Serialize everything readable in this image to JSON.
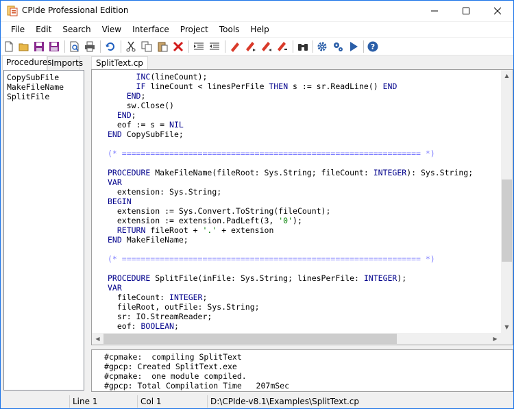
{
  "window": {
    "title": "CPIde Professional Edition"
  },
  "menu": [
    "File",
    "Edit",
    "Search",
    "View",
    "Interface",
    "Project",
    "Tools",
    "Help"
  ],
  "toolbar_icons": [
    "new-file-icon",
    "open-folder-icon",
    "save-icon",
    "save-all-icon",
    "print-preview-icon",
    "print-icon",
    "undo-icon",
    "cut-icon",
    "copy-icon",
    "paste-icon",
    "delete-icon",
    "indent-icon",
    "outdent-icon",
    "bookmark-icon",
    "bookmark-next-icon",
    "bookmark-prev-icon",
    "bookmark-clear-icon",
    "find-icon",
    "settings-icon",
    "build-icon",
    "run-icon",
    "help-icon"
  ],
  "left_panel": {
    "tabs": [
      "Procedures",
      "Imports"
    ],
    "items": [
      "CopySubFile",
      "MakeFileName",
      "SplitFile"
    ]
  },
  "editor": {
    "tab": "SplitText.cp",
    "lines": [
      "      INC(lineCount);",
      "      IF lineCount < linesPerFile THEN s := sr.ReadLine() END",
      "    END;",
      "    sw.Close()",
      "  END;",
      "  eof := s = NIL",
      "END CopySubFile;",
      "",
      "(* =============================================================== *)",
      "",
      "PROCEDURE MakeFileName(fileRoot: Sys.String; fileCount: INTEGER): Sys.String;",
      "VAR",
      "  extension: Sys.String;",
      "BEGIN",
      "  extension := Sys.Convert.ToString(fileCount);",
      "  extension := extension.PadLeft(3, '0');",
      "  RETURN fileRoot + '.' + extension",
      "END MakeFileName;",
      "",
      "(* =============================================================== *)",
      "",
      "PROCEDURE SplitFile(inFile: Sys.String; linesPerFile: INTEGER);",
      "VAR",
      "  fileCount: INTEGER;",
      "  fileRoot, outFile: Sys.String;",
      "  sr: IO.StreamReader;",
      "  eof: BOOLEAN;"
    ]
  },
  "output": {
    "lines": [
      "#cpmake:  compiling SplitText",
      "#gpcp: Created SplitText.exe",
      "#cpmake:  one module compiled.",
      "#gpcp: Total Compilation Time   207mSec"
    ]
  },
  "status": {
    "line": "Line 1",
    "col": "Col 1",
    "path": "D:\\CPIde-v8.1\\Examples\\SplitText.cp"
  },
  "colors": {
    "keyword": "#00008b",
    "comment": "#7f7fff",
    "string": "#008000"
  }
}
